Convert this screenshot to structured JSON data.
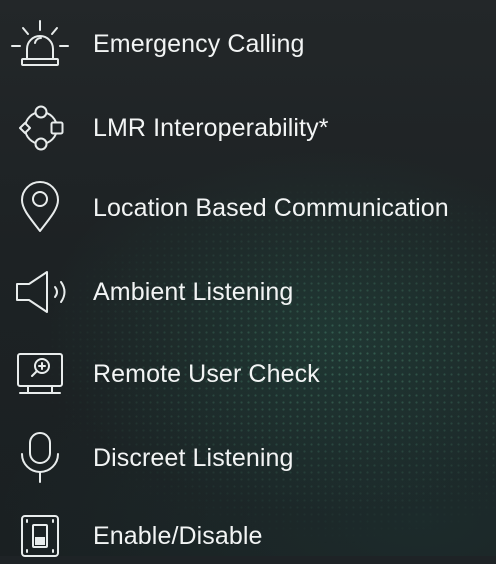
{
  "features": [
    {
      "label": "Emergency Calling",
      "icon": "alarm-beacon-icon"
    },
    {
      "label": "LMR Interoperability*",
      "icon": "network-nodes-icon"
    },
    {
      "label": "Location Based Communication",
      "icon": "location-pin-icon"
    },
    {
      "label": "Ambient Listening",
      "icon": "speaker-icon"
    },
    {
      "label": "Remote User Check",
      "icon": "monitor-search-icon"
    },
    {
      "label": "Discreet Listening",
      "icon": "microphone-icon"
    },
    {
      "label": "Enable/Disable",
      "icon": "toggle-switch-icon"
    }
  ],
  "colors": {
    "background": "#1e2326",
    "text": "#f2f4f4",
    "icon_stroke": "#e8ecec",
    "dot_accent": "#5faf8c"
  }
}
